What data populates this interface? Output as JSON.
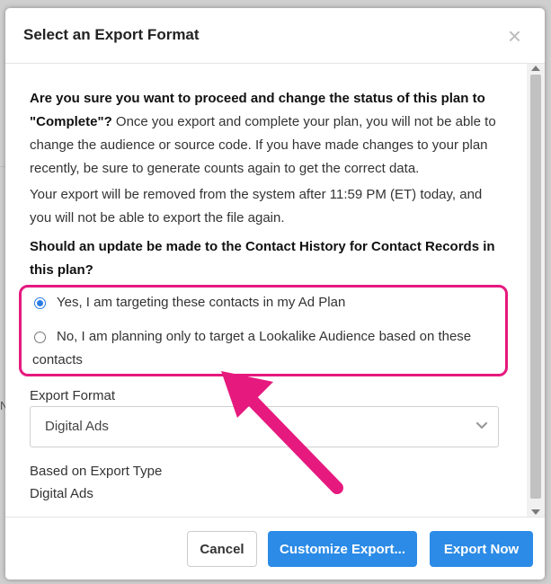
{
  "background": {
    "partial_text": "N"
  },
  "modal": {
    "title": "Select an Export Format",
    "close_symbol": "×",
    "warning_bold": "Are you sure you want to proceed and change the status of this plan to \"Complete\"?",
    "warning_rest": " Once you export and complete your plan, you will not be able to change the audience or source code. If you have made changes to your plan recently, be sure to generate counts again to get the correct data.",
    "removal_notice": "Your export will be removed from the system after 11:59 PM (ET) today, and you will not be able to export the file again.",
    "question": "Should an update be made to the Contact History for Contact Records in this plan?",
    "options": [
      {
        "label": "Yes, I am targeting these contacts in my Ad Plan",
        "checked": true
      },
      {
        "label": "No, I am planning only to target a Lookalike Audience based on these contacts",
        "checked": false
      }
    ],
    "export_format_label": "Export Format",
    "export_format_value": "Digital Ads",
    "export_type_label": "Based on Export Type",
    "export_type_value": "Digital Ads"
  },
  "footer": {
    "cancel_label": "Cancel",
    "customize_label": "Customize Export...",
    "export_label": "Export Now"
  },
  "colors": {
    "primary": "#2b8be6",
    "highlight": "#e6197e",
    "radio_checked": "#2b7de1"
  }
}
